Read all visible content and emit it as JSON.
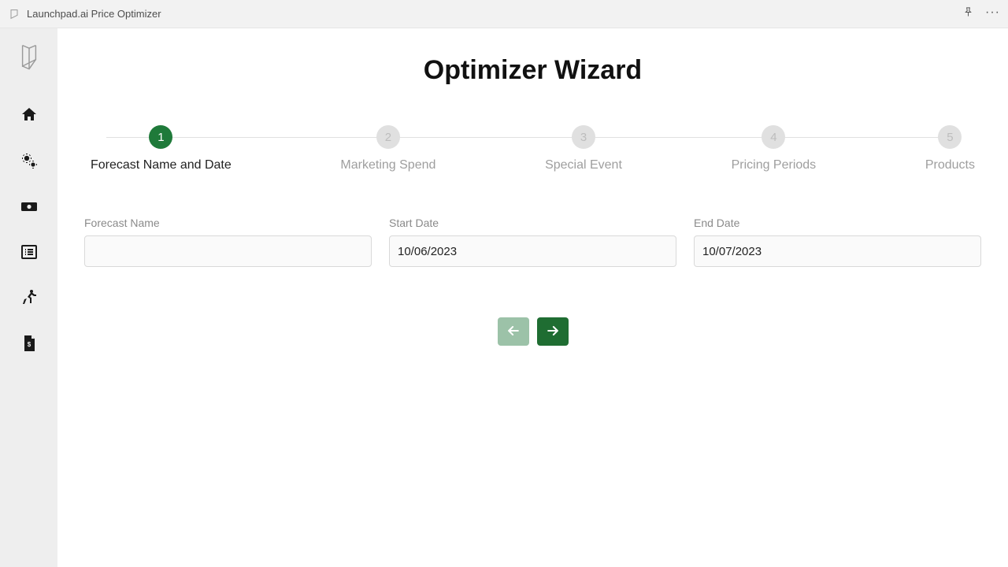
{
  "window": {
    "title": "Launchpad.ai Price Optimizer"
  },
  "page": {
    "title": "Optimizer Wizard"
  },
  "stepper": {
    "active_index": 0,
    "steps": [
      {
        "num": "1",
        "label": "Forecast Name and Date"
      },
      {
        "num": "2",
        "label": "Marketing Spend"
      },
      {
        "num": "3",
        "label": "Special Event"
      },
      {
        "num": "4",
        "label": "Pricing Periods"
      },
      {
        "num": "5",
        "label": "Products"
      }
    ]
  },
  "form": {
    "forecast_name": {
      "label": "Forecast Name",
      "value": ""
    },
    "start_date": {
      "label": "Start Date",
      "value": "10/06/2023"
    },
    "end_date": {
      "label": "End Date",
      "value": "10/07/2023"
    }
  },
  "sidebar": {
    "items": [
      {
        "name": "home"
      },
      {
        "name": "settings"
      },
      {
        "name": "money"
      },
      {
        "name": "list"
      },
      {
        "name": "run"
      },
      {
        "name": "invoice"
      }
    ]
  }
}
